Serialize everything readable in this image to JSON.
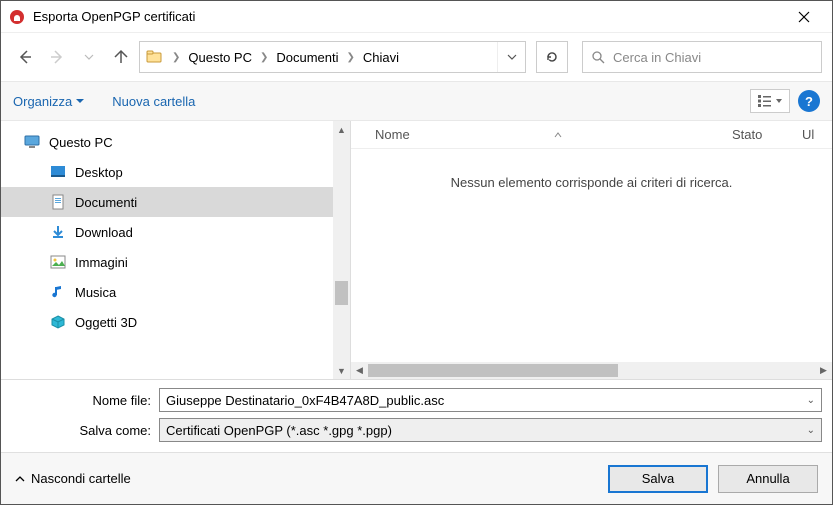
{
  "titlebar": {
    "title": "Esporta OpenPGP certificati"
  },
  "breadcrumb": {
    "crumbs": [
      "Questo PC",
      "Documenti",
      "Chiavi"
    ]
  },
  "search": {
    "placeholder": "Cerca in Chiavi"
  },
  "toolbar": {
    "organize": "Organizza",
    "newfolder": "Nuova cartella"
  },
  "tree": {
    "root": "Questo PC",
    "items": [
      {
        "label": "Desktop"
      },
      {
        "label": "Documenti"
      },
      {
        "label": "Download"
      },
      {
        "label": "Immagini"
      },
      {
        "label": "Musica"
      },
      {
        "label": "Oggetti 3D"
      }
    ]
  },
  "columns": {
    "name": "Nome",
    "state": "Stato",
    "ul": "Ul"
  },
  "empty": "Nessun elemento corrisponde ai criteri di ricerca.",
  "form": {
    "filename_label": "Nome file:",
    "filename_value": "Giuseppe Destinatario_0xF4B47A8D_public.asc",
    "saveas_label": "Salva come:",
    "saveas_value": "Certificati OpenPGP (*.asc *.gpg *.pgp)"
  },
  "footer": {
    "hide": "Nascondi cartelle",
    "save": "Salva",
    "cancel": "Annulla"
  }
}
